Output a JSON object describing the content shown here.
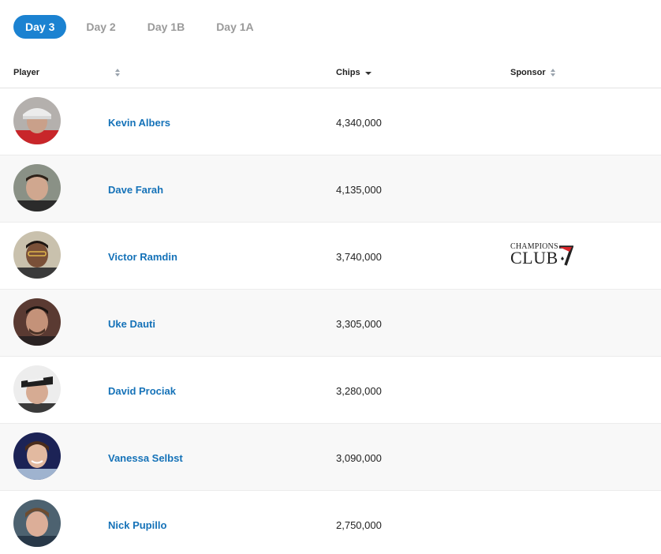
{
  "tabs": [
    {
      "label": "Day 3",
      "active": true
    },
    {
      "label": "Day 2",
      "active": false
    },
    {
      "label": "Day 1B",
      "active": false
    },
    {
      "label": "Day 1A",
      "active": false
    }
  ],
  "table": {
    "headers": {
      "player": "Player",
      "chips": "Chips",
      "sponsor": "Sponsor"
    },
    "sort": {
      "column": "chips",
      "direction": "desc"
    },
    "rows": [
      {
        "name": "Kevin Albers",
        "chips": "4,340,000",
        "sponsor": ""
      },
      {
        "name": "Dave Farah",
        "chips": "4,135,000",
        "sponsor": ""
      },
      {
        "name": "Victor Ramdin",
        "chips": "3,740,000",
        "sponsor": {
          "top": "CHAMPIONS",
          "main": "CLUB",
          "mark": "7"
        }
      },
      {
        "name": "Uke Dauti",
        "chips": "3,305,000",
        "sponsor": ""
      },
      {
        "name": "David Prociak",
        "chips": "3,280,000",
        "sponsor": ""
      },
      {
        "name": "Vanessa Selbst",
        "chips": "3,090,000",
        "sponsor": ""
      },
      {
        "name": "Nick Pupillo",
        "chips": "2,750,000",
        "sponsor": ""
      }
    ]
  },
  "colors": {
    "accent": "#1b82d1",
    "link": "#1572b8",
    "row_alt": "#f8f8f8",
    "border": "#e3e3e3",
    "sponsor_red": "#d8262b"
  }
}
